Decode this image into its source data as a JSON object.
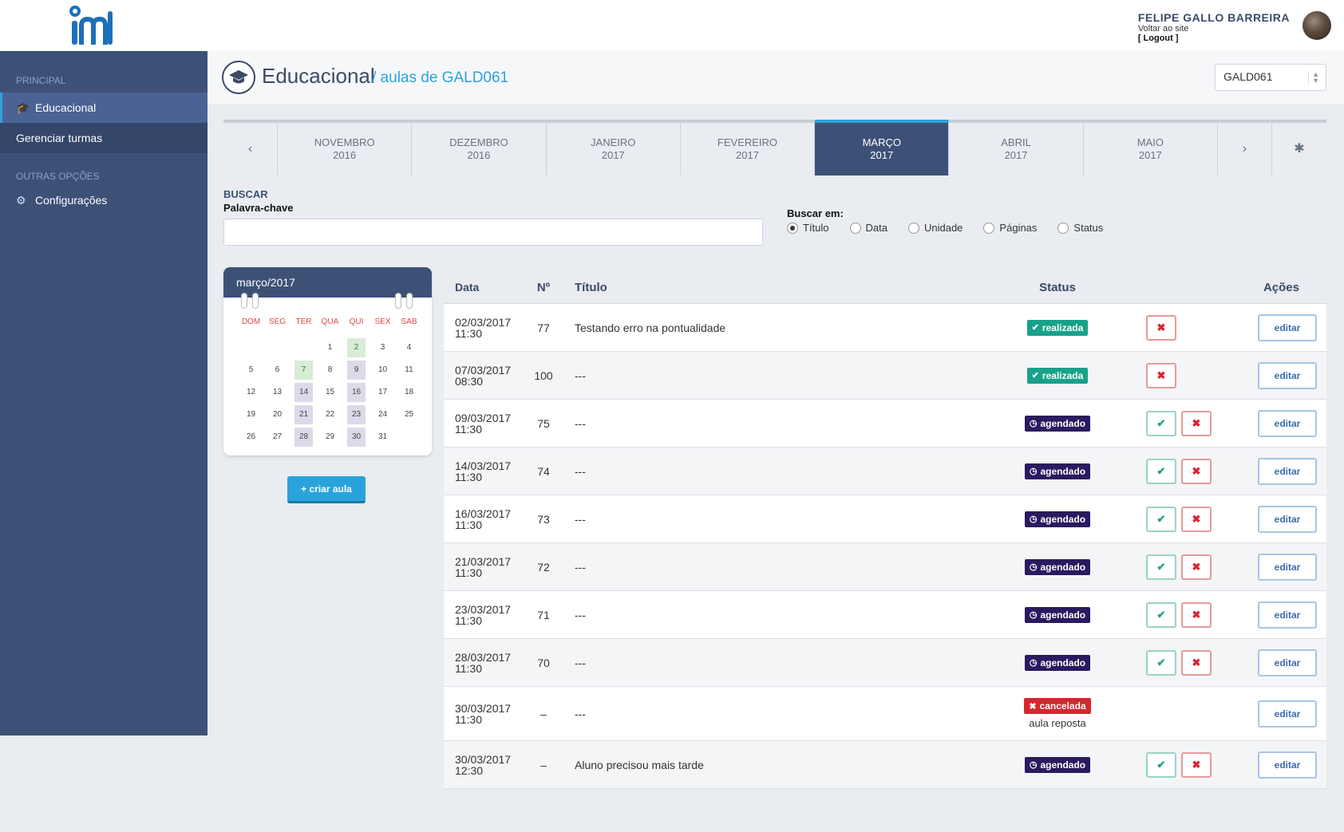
{
  "header": {
    "user_name": "FELIPE GALLO BARREIRA",
    "back_link": "Voltar ao site",
    "logout": "[ Logout ]"
  },
  "sidebar": {
    "section_main": "PRINCIPAL",
    "items": [
      {
        "label": "Educacional",
        "icon": "graduation-cap-icon"
      },
      {
        "label": "Gerenciar turmas"
      }
    ],
    "section_other": "OUTRAS OPÇÕES",
    "other_items": [
      {
        "label": "Configurações",
        "icon": "gear-icon"
      }
    ]
  },
  "page": {
    "title": "Educacional",
    "subtitle": "/ aulas de GALD061",
    "class_select": "GALD061"
  },
  "months": [
    {
      "month": "NOVEMBRO",
      "year": "2016"
    },
    {
      "month": "DEZEMBRO",
      "year": "2016"
    },
    {
      "month": "JANEIRO",
      "year": "2017"
    },
    {
      "month": "FEVEREIRO",
      "year": "2017"
    },
    {
      "month": "MARÇO",
      "year": "2017"
    },
    {
      "month": "ABRIL",
      "year": "2017"
    },
    {
      "month": "MAIO",
      "year": "2017"
    }
  ],
  "month_nav": {
    "prev": "‹",
    "next": "›",
    "star": "✱"
  },
  "search": {
    "title": "BUSCAR",
    "keyword_label": "Palavra-chave",
    "keyword_value": "",
    "in_label": "Buscar em:",
    "options": [
      "Título",
      "Data",
      "Unidade",
      "Páginas",
      "Status"
    ],
    "selected": "Título"
  },
  "calendar": {
    "title": "março/2017",
    "weekdays": [
      "DOM",
      "SEG",
      "TER",
      "QUA",
      "QUI",
      "SEX",
      "SAB"
    ],
    "days": [
      "",
      "",
      "",
      "1",
      "2",
      "3",
      "4",
      "5",
      "6",
      "7",
      "8",
      "9",
      "10",
      "11",
      "12",
      "13",
      "14",
      "15",
      "16",
      "17",
      "18",
      "19",
      "20",
      "21",
      "22",
      "23",
      "24",
      "25",
      "26",
      "27",
      "28",
      "29",
      "30",
      "31",
      ""
    ],
    "green_days": [
      "2",
      "7"
    ],
    "lilac_days": [
      "9",
      "14",
      "16",
      "21",
      "23",
      "28",
      "30"
    ]
  },
  "create_button": "+ criar aula",
  "table": {
    "headers": {
      "date": "Data",
      "num": "Nº",
      "title": "Título",
      "status": "Status",
      "actions": "Ações"
    },
    "edit_label": "editar",
    "rows": [
      {
        "date": "02/03/2017",
        "time": "11:30",
        "num": "77",
        "title": "Testando erro na pontualidade",
        "status": "realizada"
      },
      {
        "date": "07/03/2017",
        "time": "08:30",
        "num": "100",
        "title": "---",
        "status": "realizada"
      },
      {
        "date": "09/03/2017",
        "time": "11:30",
        "num": "75",
        "title": "---",
        "status": "agendado"
      },
      {
        "date": "14/03/2017",
        "time": "11:30",
        "num": "74",
        "title": "---",
        "status": "agendado"
      },
      {
        "date": "16/03/2017",
        "time": "11:30",
        "num": "73",
        "title": "---",
        "status": "agendado"
      },
      {
        "date": "21/03/2017",
        "time": "11:30",
        "num": "72",
        "title": "---",
        "status": "agendado"
      },
      {
        "date": "23/03/2017",
        "time": "11:30",
        "num": "71",
        "title": "---",
        "status": "agendado"
      },
      {
        "date": "28/03/2017",
        "time": "11:30",
        "num": "70",
        "title": "---",
        "status": "agendado"
      },
      {
        "date": "30/03/2017",
        "time": "11:30",
        "num": "–",
        "title": "---",
        "status": "cancelada",
        "note": "aula reposta"
      },
      {
        "date": "30/03/2017",
        "time": "12:30",
        "num": "–",
        "title": "Aluno precisou mais tarde",
        "status": "agendado"
      }
    ]
  },
  "colors": {
    "sidebar": "#3d5177",
    "accent": "#2aa3dc",
    "realizada": "#1aa189",
    "agendado": "#2a1a5e",
    "cancelada": "#d7262e"
  }
}
